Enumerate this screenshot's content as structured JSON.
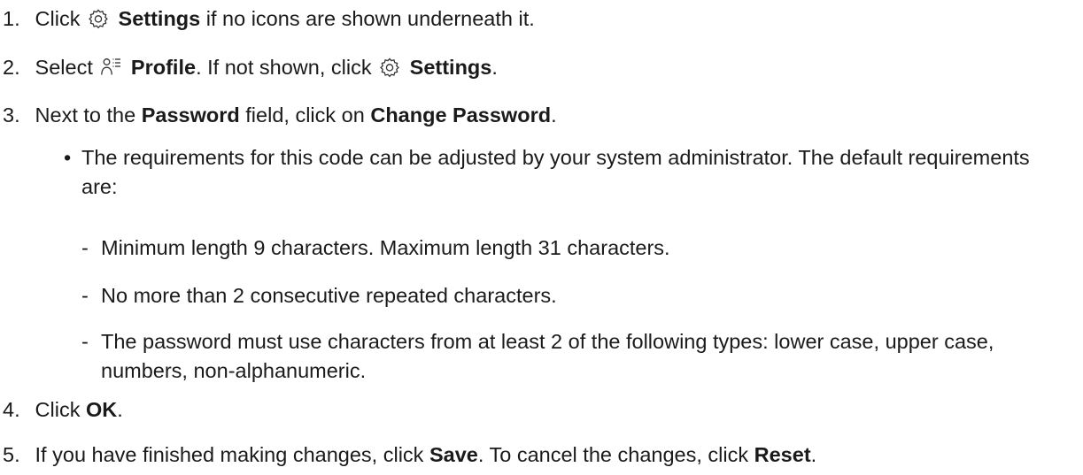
{
  "steps": [
    {
      "num": "1.",
      "t1": "Click",
      "bold1": "Settings",
      "t2": "if no icons are shown underneath it."
    },
    {
      "num": "2.",
      "t1": "Select",
      "bold1": "Profile",
      "t2": ". If not shown, click",
      "bold2": "Settings",
      "t3": "."
    },
    {
      "num": "3.",
      "t1": "Next to the",
      "bold1": "Password",
      "t2": "field, click on",
      "bold2": "Change Password",
      "t3": "."
    },
    {
      "num": "4.",
      "t1": "Click",
      "bold1": "OK",
      "t2": "."
    },
    {
      "num": "5.",
      "t1": "If you have finished making changes, click",
      "bold1": "Save",
      "t2": ". To cancel the changes, click",
      "bold2": "Reset",
      "t3": "."
    }
  ],
  "bullet": {
    "marker": "•",
    "text": "The requirements for this code can be adjusted by your system administrator. The default requirements are:"
  },
  "subitems": [
    {
      "marker": "-",
      "text": "Minimum length 9 characters. Maximum length 31 characters."
    },
    {
      "marker": "-",
      "text": "No more than 2 consecutive repeated characters."
    },
    {
      "marker": "-",
      "text": "The password must use characters from at least 2 of the following types: lower case, upper case, numbers, non-alphanumeric."
    }
  ],
  "icons": {
    "settings": "gear-icon",
    "profile": "profile-list-icon"
  }
}
